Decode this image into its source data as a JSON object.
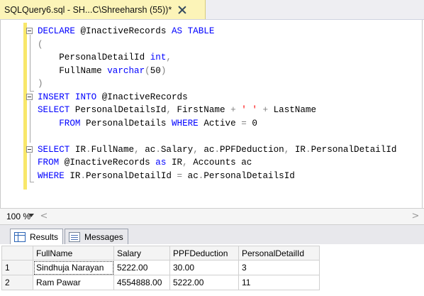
{
  "tab": {
    "title": "SQLQuery6.sql - SH...C\\Shreeharsh (55))*"
  },
  "editor": {
    "lines": [
      [
        {
          "t": "DECLARE ",
          "c": "kw"
        },
        {
          "t": "@InactiveRecords ",
          "c": ""
        },
        {
          "t": "AS TABLE",
          "c": "kw"
        }
      ],
      [
        {
          "t": "(",
          "c": "gr"
        }
      ],
      [
        {
          "t": "    PersonalDetailId ",
          "c": ""
        },
        {
          "t": "int",
          "c": "kw"
        },
        {
          "t": ",",
          "c": "gr"
        }
      ],
      [
        {
          "t": "    FullName ",
          "c": ""
        },
        {
          "t": "varchar",
          "c": "kw"
        },
        {
          "t": "(",
          "c": "gr"
        },
        {
          "t": "50",
          "c": ""
        },
        {
          "t": ")",
          "c": "gr"
        }
      ],
      [
        {
          "t": ")",
          "c": "gr"
        }
      ],
      [
        {
          "t": "INSERT INTO ",
          "c": "kw"
        },
        {
          "t": "@InactiveRecords",
          "c": ""
        }
      ],
      [
        {
          "t": "SELECT ",
          "c": "kw"
        },
        {
          "t": "PersonalDetailsId",
          "c": ""
        },
        {
          "t": ", ",
          "c": "gr"
        },
        {
          "t": "FirstName ",
          "c": ""
        },
        {
          "t": "+ ",
          "c": "gr"
        },
        {
          "t": "' ' ",
          "c": "str"
        },
        {
          "t": "+ ",
          "c": "gr"
        },
        {
          "t": "LastName",
          "c": ""
        }
      ],
      [
        {
          "t": "    FROM ",
          "c": "kw"
        },
        {
          "t": "PersonalDetails ",
          "c": ""
        },
        {
          "t": "WHERE ",
          "c": "kw"
        },
        {
          "t": "Active ",
          "c": ""
        },
        {
          "t": "= ",
          "c": "gr"
        },
        {
          "t": "0",
          "c": ""
        }
      ],
      [
        {
          "t": "",
          "c": ""
        }
      ],
      [
        {
          "t": "SELECT ",
          "c": "kw"
        },
        {
          "t": "IR",
          "c": ""
        },
        {
          "t": ".",
          "c": "gr"
        },
        {
          "t": "FullName",
          "c": ""
        },
        {
          "t": ", ",
          "c": "gr"
        },
        {
          "t": "ac",
          "c": ""
        },
        {
          "t": ".",
          "c": "gr"
        },
        {
          "t": "Salary",
          "c": ""
        },
        {
          "t": ", ",
          "c": "gr"
        },
        {
          "t": "ac",
          "c": ""
        },
        {
          "t": ".",
          "c": "gr"
        },
        {
          "t": "PPFDeduction",
          "c": ""
        },
        {
          "t": ", ",
          "c": "gr"
        },
        {
          "t": "IR",
          "c": ""
        },
        {
          "t": ".",
          "c": "gr"
        },
        {
          "t": "PersonalDetailId",
          "c": ""
        }
      ],
      [
        {
          "t": "FROM ",
          "c": "kw"
        },
        {
          "t": "@InactiveRecords ",
          "c": ""
        },
        {
          "t": "as ",
          "c": "kw"
        },
        {
          "t": "IR",
          "c": ""
        },
        {
          "t": ", ",
          "c": "gr"
        },
        {
          "t": "Accounts ",
          "c": ""
        },
        {
          "t": "ac",
          "c": ""
        }
      ],
      [
        {
          "t": "WHERE ",
          "c": "kw"
        },
        {
          "t": "IR",
          "c": ""
        },
        {
          "t": ".",
          "c": "gr"
        },
        {
          "t": "PersonalDetailId ",
          "c": ""
        },
        {
          "t": "= ",
          "c": "gr"
        },
        {
          "t": "ac",
          "c": ""
        },
        {
          "t": ".",
          "c": "gr"
        },
        {
          "t": "PersonalDetailsId",
          "c": ""
        }
      ]
    ]
  },
  "statusbar": {
    "zoom": "100 %",
    "scroll_left": "<",
    "scroll_right": ">"
  },
  "results_tabs": {
    "results_label": "Results",
    "messages_label": "Messages"
  },
  "grid": {
    "columns": [
      "FullName",
      "Salary",
      "PPFDeduction",
      "PersonalDetailId"
    ],
    "rows": [
      {
        "num": "1",
        "cells": [
          "Sindhuja Narayan",
          "5222.00",
          "30.00",
          "3"
        ]
      },
      {
        "num": "2",
        "cells": [
          "Ram Pawar",
          "4554888.00",
          "5222.00",
          "11"
        ]
      }
    ]
  },
  "colors": {
    "keyword": "#0000ff",
    "operator": "#808080",
    "string": "#ff0000",
    "tab_background": "#fcf4b8"
  }
}
